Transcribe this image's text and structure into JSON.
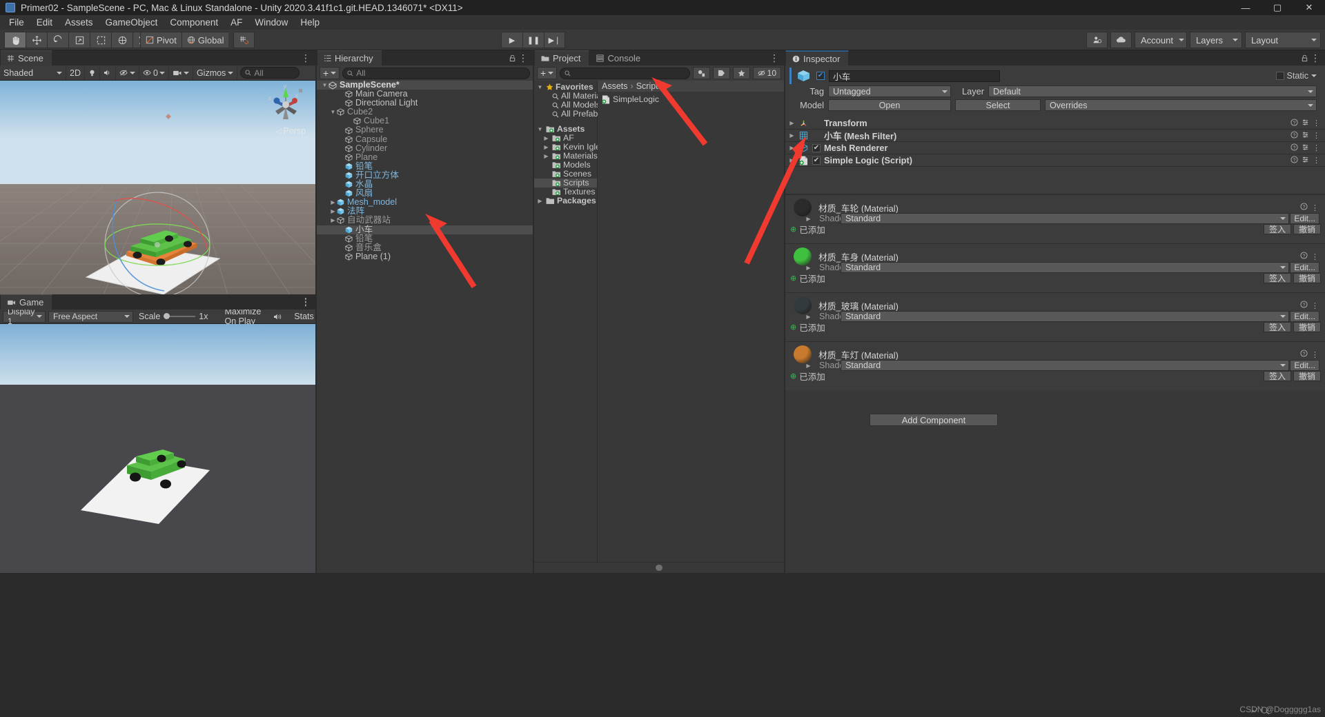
{
  "window": {
    "title": "Primer02 - SampleScene - PC, Mac & Linux Standalone - Unity 2020.3.41f1c1.git.HEAD.1346071* <DX11>",
    "minimize": "—",
    "maximize": "▢",
    "close": "✕"
  },
  "menubar": {
    "items": [
      "File",
      "Edit",
      "Assets",
      "GameObject",
      "Component",
      "AF",
      "Window",
      "Help"
    ]
  },
  "toolbar": {
    "tools": [
      "hand-tool",
      "move-tool",
      "rotate-tool",
      "scale-tool",
      "rect-tool",
      "transform-tool",
      "custom-tool"
    ],
    "pivot_label": "Pivot",
    "global_label": "Global",
    "grid_label": "grid-snap-icon",
    "play": "▶",
    "pause": "❚❚",
    "step": "▶❘",
    "collab_label": "collab-icon",
    "cloud_label": "cloud-icon",
    "account_label": "Account",
    "layers_label": "Layers",
    "layout_label": "Layout"
  },
  "scene": {
    "tab": "Scene",
    "shading": "Shaded",
    "mode_2d": "2D",
    "lighting": "lighting-icon",
    "audio": "audio-icon",
    "fx": "fx-icon",
    "visibility_count": "0",
    "camera": "camera-icon",
    "gizmos": "Gizmos",
    "search_placeholder": "All",
    "persp_label": "Persp",
    "axis_x": "x",
    "axis_y": "y",
    "axis_z": "z"
  },
  "game": {
    "tab": "Game",
    "display": "Display 1",
    "aspect": "Free Aspect",
    "scale_label": "Scale",
    "scale_value": "1x",
    "maximize": "Maximize On Play",
    "mute": "mute-audio-icon",
    "stats": "Stats"
  },
  "hierarchy": {
    "tab": "Hierarchy",
    "add_label": "+",
    "search_placeholder": "All",
    "items": [
      {
        "label": "SampleScene*",
        "depth": 0,
        "icon": "scene-icon",
        "state": "scene",
        "expanded": true
      },
      {
        "label": "Main Camera",
        "depth": 2,
        "icon": "gameobject-icon",
        "state": "normal"
      },
      {
        "label": "Directional Light",
        "depth": 2,
        "icon": "gameobject-icon",
        "state": "normal"
      },
      {
        "label": "Cube2",
        "depth": 1,
        "icon": "gameobject-icon",
        "state": "dim",
        "expanded": true
      },
      {
        "label": "Cube1",
        "depth": 3,
        "icon": "gameobject-icon",
        "state": "dim"
      },
      {
        "label": "Sphere",
        "depth": 2,
        "icon": "gameobject-icon",
        "state": "dim"
      },
      {
        "label": "Capsule",
        "depth": 2,
        "icon": "gameobject-icon",
        "state": "dim"
      },
      {
        "label": "Cylinder",
        "depth": 2,
        "icon": "gameobject-icon",
        "state": "dim"
      },
      {
        "label": "Plane",
        "depth": 2,
        "icon": "gameobject-icon",
        "state": "dim"
      },
      {
        "label": "铅笔",
        "depth": 2,
        "icon": "prefab-icon",
        "state": "prefab"
      },
      {
        "label": "开口立方体",
        "depth": 2,
        "icon": "prefab-icon",
        "state": "prefab"
      },
      {
        "label": "水晶",
        "depth": 2,
        "icon": "prefab-icon",
        "state": "prefab"
      },
      {
        "label": "风扇",
        "depth": 2,
        "icon": "prefab-icon",
        "state": "prefab"
      },
      {
        "label": "Mesh_model",
        "depth": 1,
        "icon": "prefab-icon",
        "state": "prefab",
        "collapsed": true
      },
      {
        "label": "法阵",
        "depth": 1,
        "icon": "prefab-icon",
        "state": "prefab",
        "collapsed": true
      },
      {
        "label": "自动武器站",
        "depth": 1,
        "icon": "gameobject-icon",
        "state": "dim",
        "collapsed": true
      },
      {
        "label": "小车",
        "depth": 2,
        "icon": "prefab-icon",
        "state": "selected"
      },
      {
        "label": "铅笔",
        "depth": 2,
        "icon": "gameobject-icon",
        "state": "dim"
      },
      {
        "label": "音乐盒",
        "depth": 2,
        "icon": "gameobject-icon",
        "state": "dim"
      },
      {
        "label": "Plane (1)",
        "depth": 2,
        "icon": "gameobject-icon",
        "state": "normal"
      }
    ]
  },
  "project": {
    "tab": "Project",
    "console_tab": "Console",
    "add_label": "+",
    "search_placeholder": "",
    "hidden_count": "10",
    "tree": [
      {
        "label": "Favorites",
        "depth": 0,
        "icon": "star-icon",
        "bold": true,
        "expanded": true
      },
      {
        "label": "All Materia",
        "depth": 1,
        "icon": "search-icon"
      },
      {
        "label": "All Models",
        "depth": 1,
        "icon": "search-icon"
      },
      {
        "label": "All Prefabs",
        "depth": 1,
        "icon": "search-icon"
      },
      {
        "label": "",
        "depth": 0,
        "icon": "spacer"
      },
      {
        "label": "Assets",
        "depth": 0,
        "icon": "folder-icon",
        "bold": true,
        "expanded": true
      },
      {
        "label": "AF",
        "depth": 1,
        "icon": "folder-icon",
        "collapsed": true
      },
      {
        "label": "Kevin Igles",
        "depth": 1,
        "icon": "folder-icon",
        "collapsed": true
      },
      {
        "label": "Materials",
        "depth": 1,
        "icon": "folder-icon",
        "collapsed": true
      },
      {
        "label": "Models",
        "depth": 1,
        "icon": "folder-icon"
      },
      {
        "label": "Scenes",
        "depth": 1,
        "icon": "folder-icon"
      },
      {
        "label": "Scripts",
        "depth": 1,
        "icon": "folder-icon",
        "selected": true
      },
      {
        "label": "Textures",
        "depth": 1,
        "icon": "folder-icon"
      },
      {
        "label": "Packages",
        "depth": 0,
        "icon": "folder-icon",
        "bold": true,
        "collapsed": true
      }
    ],
    "breadcrumb": [
      "Assets",
      "Scripts"
    ],
    "files": [
      {
        "label": "SimpleLogic",
        "icon": "cs-script-icon"
      }
    ]
  },
  "inspector": {
    "tab": "Inspector",
    "object_name": "小车",
    "object_enabled": true,
    "static_label": "Static",
    "tag_label": "Tag",
    "tag_value": "Untagged",
    "layer_label": "Layer",
    "layer_value": "Default",
    "model_label": "Model",
    "open_label": "Open",
    "select_label": "Select",
    "overrides_label": "Overrides",
    "components": [
      {
        "name": "Transform",
        "icon": "transform-icon",
        "has_checkbox": false
      },
      {
        "name": "小车 (Mesh Filter)",
        "icon": "mesh-filter-icon",
        "has_checkbox": false
      },
      {
        "name": "Mesh Renderer",
        "icon": "mesh-renderer-icon",
        "has_checkbox": true,
        "checked": true
      },
      {
        "name": "Simple Logic (Script)",
        "icon": "script-icon",
        "has_checkbox": true,
        "checked": true
      }
    ],
    "materials": [
      {
        "name": "材质_车轮 (Material)",
        "color": "#2b2b2b",
        "shader_label": "Shader",
        "shader_value": "Standard",
        "edit_label": "Edit...",
        "added_label": "已添加",
        "checkin_label": "签入",
        "revert_label": "撤销"
      },
      {
        "name": "材质_车身 (Material)",
        "color": "#3fc13f",
        "shader_label": "Shader",
        "shader_value": "Standard",
        "edit_label": "Edit...",
        "added_label": "已添加",
        "checkin_label": "签入",
        "revert_label": "撤销"
      },
      {
        "name": "材质_玻璃 (Material)",
        "color": "#333a3d",
        "shader_label": "Shader",
        "shader_value": "Standard",
        "edit_label": "Edit...",
        "added_label": "已添加",
        "checkin_label": "签入",
        "revert_label": "撤销"
      },
      {
        "name": "材质_车灯 (Material)",
        "color": "#c97a2e",
        "shader_label": "Shader",
        "shader_value": "Standard",
        "edit_label": "Edit...",
        "added_label": "已添加",
        "checkin_label": "签入",
        "revert_label": "撤销"
      }
    ],
    "add_component_label": "Add Component"
  },
  "watermark": "CSDN @Doggggg1as",
  "colors": {
    "accent_blue": "#4a90d9",
    "prefab_blue": "#7fb8e0",
    "green": "#2fbf4f",
    "arrow_red": "#f03a2f",
    "panel_bg": "#383838",
    "toolbar_bg": "#3c3c3c"
  }
}
